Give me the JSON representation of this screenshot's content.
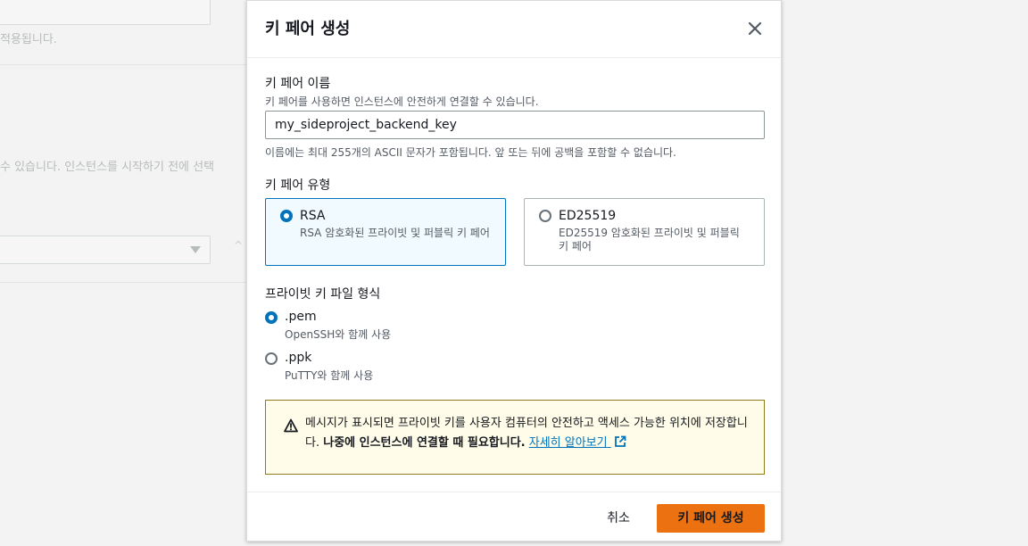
{
  "background": {
    "top_text": "적용됩니다.",
    "mid_text": "수 있습니다. 인스턴스를 시작하기 전에 선택"
  },
  "modal": {
    "title": "키 페어 생성",
    "key_name": {
      "label": "키 페어 이름",
      "description": "키 페어를 사용하면 인스턴스에 안전하게 연결할 수 있습니다.",
      "value": "my_sideproject_backend_key",
      "hint": "이름에는 최대 255개의 ASCII 문자가 포함됩니다. 앞 또는 뒤에 공백을 포함할 수 없습니다."
    },
    "key_type": {
      "label": "키 페어 유형",
      "options": [
        {
          "title": "RSA",
          "description": "RSA 암호화된 프라이빗 및 퍼블릭 키 페어",
          "selected": true
        },
        {
          "title": "ED25519",
          "description": "ED25519 암호화된 프라이빗 및 퍼블릭 키 페어",
          "selected": false
        }
      ]
    },
    "file_format": {
      "label": "프라이빗 키 파일 형식",
      "options": [
        {
          "title": ".pem",
          "description": "OpenSSH와 함께 사용",
          "selected": true
        },
        {
          "title": ".ppk",
          "description": "PuTTY와 함께 사용",
          "selected": false
        }
      ]
    },
    "alert": {
      "text_plain": "메시지가 표시되면 프라이빗 키를 사용자 컴퓨터의 안전하고 액세스 가능한 위치에 저장합니다. ",
      "text_bold": "나중에 인스턴스에 연결할 때 필요합니다.",
      "link": "자세히 알아보기"
    },
    "footer": {
      "cancel": "취소",
      "create": "키 페어 생성"
    }
  },
  "colors": {
    "accent": "#0073bb",
    "primary_button": "#ec7211",
    "warning_border": "#8f7a1e",
    "warning_bg": "#fffce9"
  },
  "icons": {
    "close": "close-icon",
    "warning": "warning-icon",
    "external_link": "external-link-icon"
  }
}
